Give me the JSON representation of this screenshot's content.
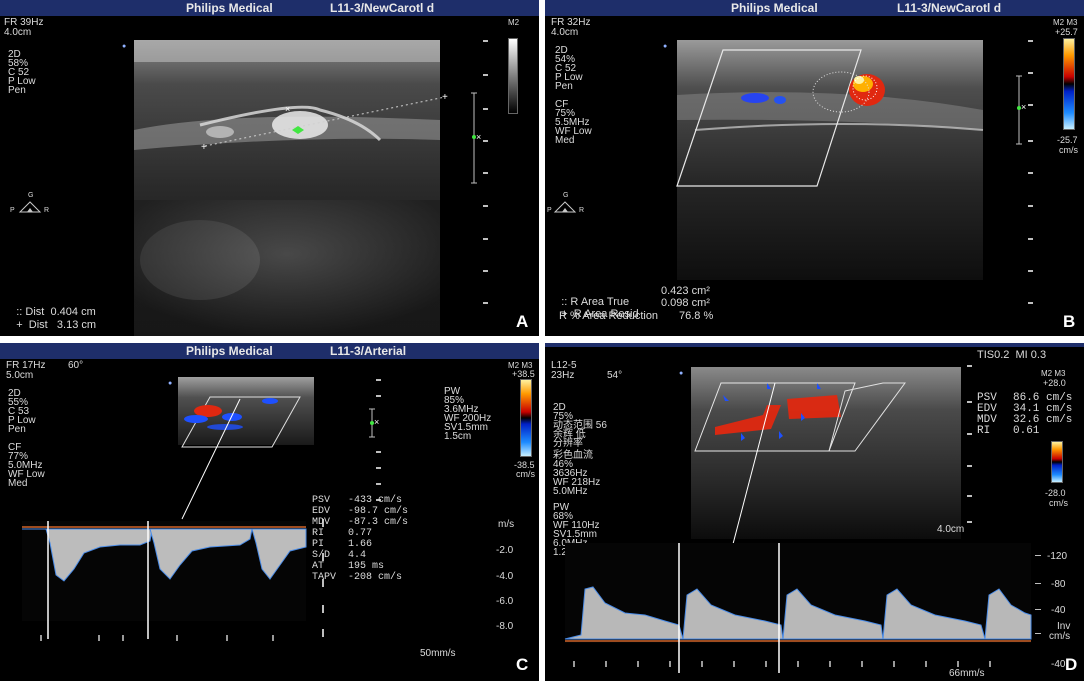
{
  "panel_a": {
    "letter": "A",
    "vendor": "Philips Medical",
    "probe": "L11-3/NewCarotl d",
    "fr": "FR 39Hz",
    "depth": "4.0cm",
    "mode_block": [
      "2D",
      "58%",
      "C 52",
      "P Low",
      "Pen"
    ],
    "marker_label": "M2",
    "orient": {
      "top": "G",
      "left": "P",
      "right": "R"
    },
    "measurements": [
      {
        "symbol": "::",
        "label": "Dist",
        "value": "0.404 cm"
      },
      {
        "symbol": "+",
        "label": "Dist",
        "value": "3.13 cm"
      }
    ]
  },
  "panel_b": {
    "letter": "B",
    "vendor": "Philips Medical",
    "probe": "L11-3/NewCarotl d",
    "fr": "FR 32Hz",
    "depth": "4.0cm",
    "mode_block": [
      "2D",
      "54%",
      "C 52",
      "P Low",
      "Pen"
    ],
    "cf_block": [
      "CF",
      "75%",
      "5.5MHz",
      "WF Low",
      "Med"
    ],
    "marker_label": "M2 M3",
    "scale_top": "+25.7",
    "scale_bottom": "-25.7",
    "scale_unit": "cm/s",
    "orient": {
      "top": "G",
      "left": "P",
      "right": "R"
    },
    "measurements": [
      {
        "symbol": "::",
        "label": "R Area True",
        "value": "0.423 cm²"
      },
      {
        "symbol": "+",
        "label": "R Area Resid",
        "value": "0.098 cm²"
      },
      {
        "symbol": "",
        "label": "R % Area Reduction",
        "value": "76.8 %"
      }
    ]
  },
  "panel_c": {
    "letter": "C",
    "vendor": "Philips Medical",
    "probe": "L11-3/Arterial",
    "fr": "FR 17Hz",
    "angle": "60°",
    "depth": "5.0cm",
    "mode_block": [
      "2D",
      "55%",
      "C 53",
      "P Low",
      "Pen"
    ],
    "cf_block": [
      "CF",
      "77%",
      "5.0MHz",
      "WF Low",
      "Med"
    ],
    "pw_block": [
      "PW",
      "85%",
      "3.6MHz",
      "WF 200Hz",
      "SV1.5mm",
      "1.5cm"
    ],
    "marker_label": "M2 M3",
    "scale_top": "+38.5",
    "scale_bottom": "-38.5",
    "scale_unit": "cm/s",
    "measurements": [
      {
        "label": "PSV",
        "value": "-433 cm/s"
      },
      {
        "label": "EDV",
        "value": "-98.7 cm/s"
      },
      {
        "label": "MDV",
        "value": "-87.3 cm/s"
      },
      {
        "label": "RI",
        "value": "0.77"
      },
      {
        "label": "PI",
        "value": "1.66"
      },
      {
        "label": "S/D",
        "value": "4.4"
      },
      {
        "label": "AT",
        "value": "195 ms"
      },
      {
        "label": "TAPV",
        "value": "-208 cm/s"
      }
    ],
    "velocity_axis": [
      "m/s",
      "-2.0",
      "-4.0",
      "-6.0",
      "-8.0"
    ],
    "sweep": "50mm/s"
  },
  "panel_d": {
    "letter": "D",
    "probe": "L12-5",
    "fr": "23Hz",
    "angle": "54°",
    "tis_mi": "TIS0.2  MI 0.3",
    "mode_block": [
      "2D",
      "75%",
      "动态范围 56",
      "余辉 低",
      "分辨率"
    ],
    "cf_block": [
      "彩色血流",
      "46%",
      "3636Hz",
      "WF 218Hz",
      "5.0MHz"
    ],
    "pw_block": [
      "PW",
      "68%",
      "WF 110Hz",
      "SV1.5mm",
      "6.0MHz",
      "1.2cm"
    ],
    "marker_label": "M2 M3",
    "scale_top": "+28.0",
    "scale_bottom": "-28.0",
    "scale_unit": "cm/s",
    "depth": "4.0cm",
    "measurements": [
      {
        "label": "PSV",
        "value": "86.6 cm/s"
      },
      {
        "label": "EDV",
        "value": "34.1 cm/s"
      },
      {
        "label": "MDV",
        "value": "32.6 cm/s"
      },
      {
        "label": "RI",
        "value": "0.61"
      }
    ],
    "velocity_axis": [
      "-120",
      "-80",
      "-40",
      "Inv",
      "cm/s",
      "-40"
    ],
    "sweep": "66mm/s"
  },
  "colors": {
    "topbar": "#1e2e6a",
    "measure_green": "#42e742",
    "baseline_orange": "#d0642a",
    "doppler_blue": "#1e50ff",
    "doppler_red": "#e02810"
  }
}
